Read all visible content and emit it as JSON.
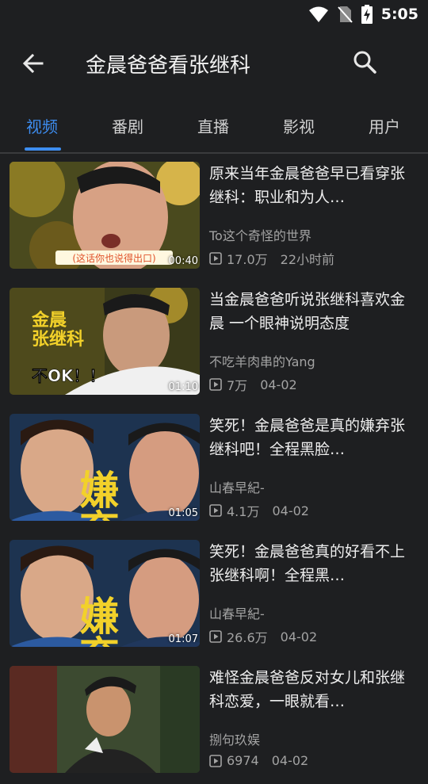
{
  "status": {
    "time": "5:05"
  },
  "header": {
    "title": "金晨爸爸看张继科"
  },
  "tabs": [
    {
      "label": "视频"
    },
    {
      "label": "番剧"
    },
    {
      "label": "直播"
    },
    {
      "label": "影视"
    },
    {
      "label": "用户"
    }
  ],
  "videos": [
    {
      "title": "原来当年金晨爸爸早已看穿张继科：职业和为人…",
      "author": "To这个奇怪的世界",
      "views": "17.0万",
      "date": "22小时前",
      "duration": "00:40",
      "caption": "(这话你也说得出口)"
    },
    {
      "title": "当金晨爸爸听说张继科喜欢金晨 一个眼神说明态度",
      "author": "不吃羊肉串的Yang",
      "views": "7万",
      "date": "04-02",
      "duration": "01:10",
      "caption_lines": [
        "金晨",
        "张继科",
        "不OK！！"
      ]
    },
    {
      "title": "笑死！金晨爸爸是真的嫌弃张继科吧！全程黑脸…",
      "author": "山春早紀-",
      "views": "4.1万",
      "date": "04-02",
      "duration": "01:05",
      "caption": "嫌弃"
    },
    {
      "title": "笑死！金晨爸爸真的好看不上张继科啊！全程黑…",
      "author": "山春早紀-",
      "views": "26.6万",
      "date": "04-02",
      "duration": "01:07",
      "caption": "嫌弃"
    },
    {
      "title": "难怪金晨爸爸反对女儿和张继科恋爱，一眼就看…",
      "author": "捌句玖娱",
      "views": "6974",
      "date": "04-02",
      "duration": "",
      "caption": ""
    }
  ]
}
